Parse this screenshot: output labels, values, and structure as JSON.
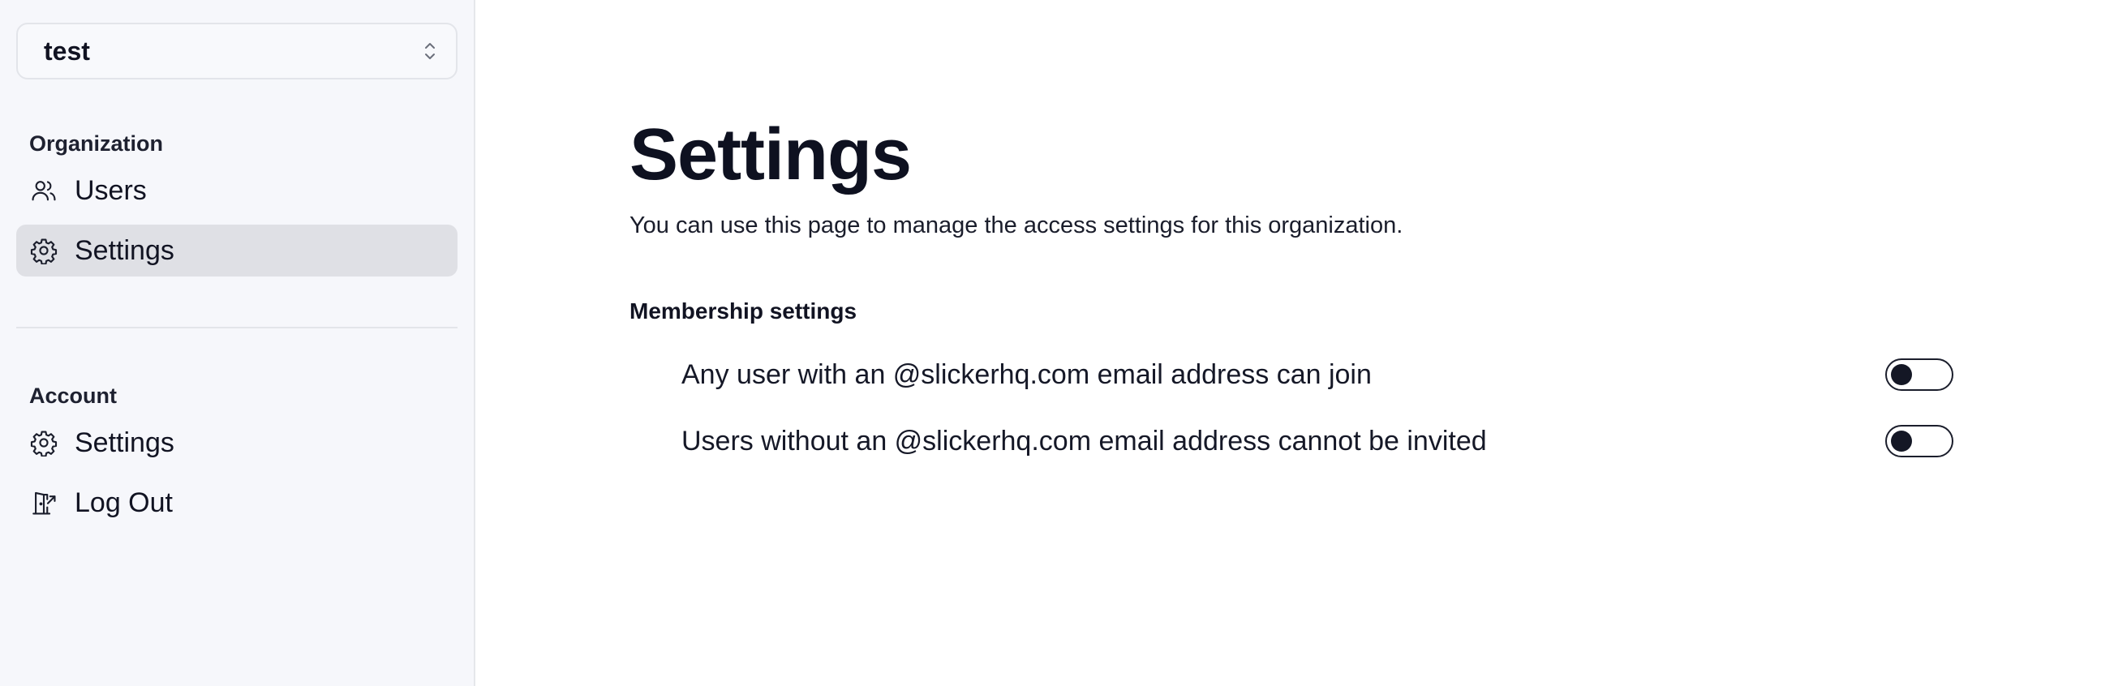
{
  "sidebar": {
    "org_selector": {
      "name": "test",
      "icon": "chevron-up-down-icon"
    },
    "organization_section": {
      "label": "Organization",
      "items": [
        {
          "label": "Users",
          "icon": "users-icon",
          "active": false
        },
        {
          "label": "Settings",
          "icon": "gear-icon",
          "active": true
        }
      ]
    },
    "account_section": {
      "label": "Account",
      "items": [
        {
          "label": "Settings",
          "icon": "gear-icon",
          "active": false
        },
        {
          "label": "Log Out",
          "icon": "logout-door-icon",
          "active": false
        }
      ]
    }
  },
  "main": {
    "title": "Settings",
    "description": "You can use this page to manage the access settings for this organization.",
    "membership": {
      "title": "Membership settings",
      "settings": [
        {
          "label": "Any user with an @slickerhq.com email address can join",
          "enabled": false
        },
        {
          "label": "Users without an @slickerhq.com email address cannot be invited",
          "enabled": false
        }
      ]
    }
  },
  "colors": {
    "sidebar_bg": "#f6f7fb",
    "active_item_bg": "#dfe0e5",
    "text_primary": "#0e1120",
    "toggle_knob": "#141725"
  }
}
